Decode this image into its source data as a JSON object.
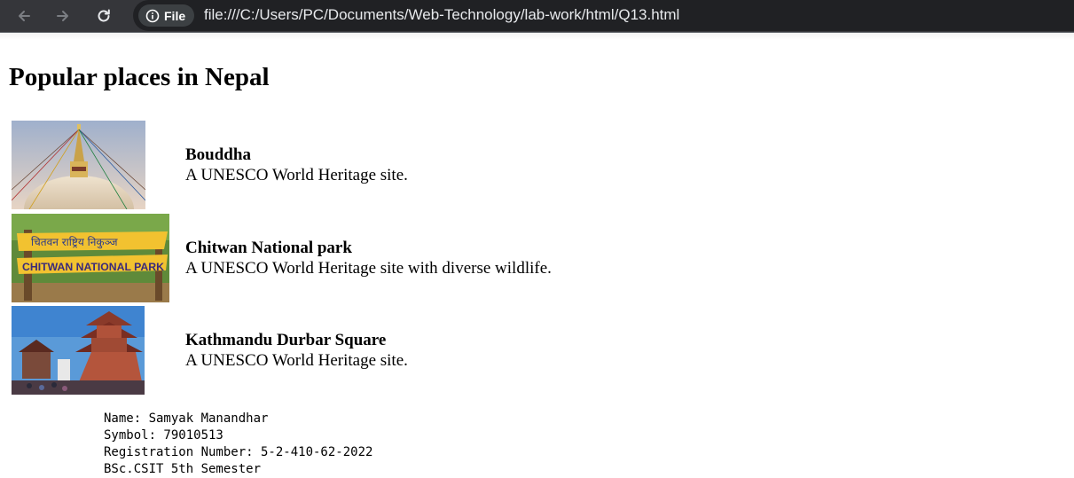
{
  "browser": {
    "site_chip_label": "File",
    "url": "file:///C:/Users/PC/Documents/Web-Technology/lab-work/html/Q13.html"
  },
  "page": {
    "heading": "Popular places in Nepal",
    "places": [
      {
        "name": "Bouddha",
        "description": "A UNESCO World Heritage site."
      },
      {
        "name": "Chitwan National park",
        "description": "A UNESCO World Heritage site with diverse wildlife."
      },
      {
        "name": "Kathmandu Durbar Square",
        "description": "A UNESCO World Heritage site."
      }
    ],
    "image_texts": {
      "chitwan_sign_devanagari": "चितवन राष्ट्रिय निकुञ्ज",
      "chitwan_sign_english": "CHITWAN NATIONAL PARK"
    },
    "student_info": [
      "Name: Samyak Manandhar",
      "Symbol: 79010513",
      "Registration Number: 5-2-410-62-2022",
      "BSc.CSIT 5th Semester"
    ]
  }
}
